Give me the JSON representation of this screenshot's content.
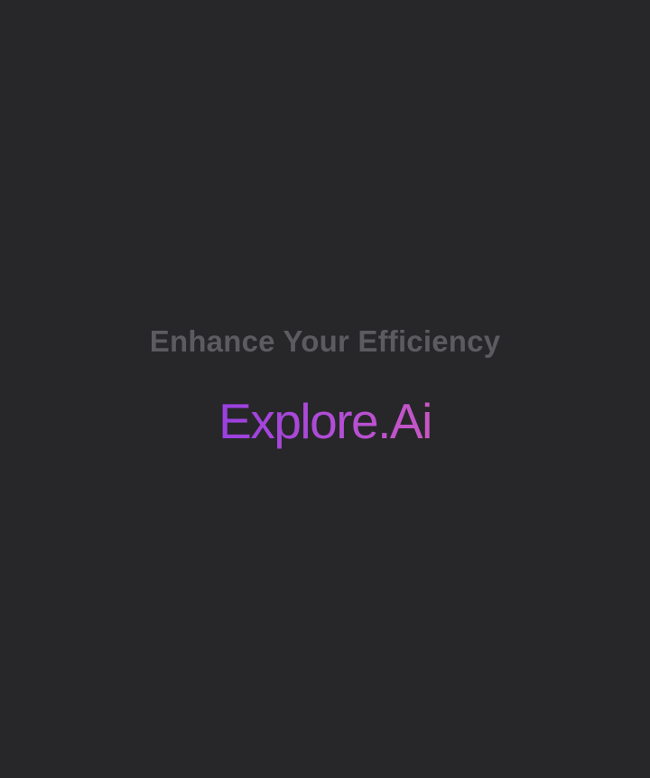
{
  "splash": {
    "tagline": "Enhance Your Efficiency",
    "brand_name": "Explore.Ai"
  },
  "colors": {
    "background": "#27272a",
    "tagline": "#5b5b60",
    "brand_gradient_start": "#9a3fe0",
    "brand_gradient_end": "#c857c3"
  }
}
